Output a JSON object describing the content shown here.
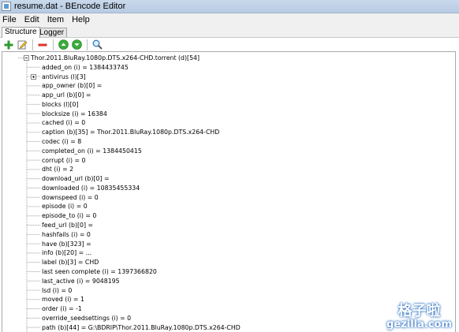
{
  "window": {
    "title": "resume.dat - BEncode Editor"
  },
  "menu": [
    "File",
    "Edit",
    "Item",
    "Help"
  ],
  "tabs": {
    "structure": "Structure",
    "logger": "Logger"
  },
  "toolbar": {
    "icons": [
      "add-icon",
      "edit-icon",
      "remove-icon",
      "move-up-icon",
      "move-down-icon",
      "search-icon"
    ]
  },
  "tree": {
    "root": "Thor.2011.BluRay.1080p.DTS.x264-CHD.torrent (d)[54]",
    "children": [
      {
        "text": "added_on (i) = 1384433745",
        "expandable": false
      },
      {
        "text": "antivirus (l)[3]",
        "expandable": true
      },
      {
        "text": "app_owner (b)[0] =",
        "expandable": false
      },
      {
        "text": "app_url (b)[0] =",
        "expandable": false
      },
      {
        "text": "blocks (l)[0]",
        "expandable": false
      },
      {
        "text": "blocksize (i) = 16384",
        "expandable": false
      },
      {
        "text": "cached (i) = 0",
        "expandable": false
      },
      {
        "text": "caption (b)[35] = Thor.2011.BluRay.1080p.DTS.x264-CHD",
        "expandable": false
      },
      {
        "text": "codec (i) = 8",
        "expandable": false
      },
      {
        "text": "completed_on (i) = 1384450415",
        "expandable": false
      },
      {
        "text": "corrupt (i) = 0",
        "expandable": false
      },
      {
        "text": "dht (i) = 2",
        "expandable": false
      },
      {
        "text": "download_url (b)[0] =",
        "expandable": false
      },
      {
        "text": "downloaded (i) = 10835455334",
        "expandable": false
      },
      {
        "text": "downspeed (i) = 0",
        "expandable": false
      },
      {
        "text": "episode (i) = 0",
        "expandable": false
      },
      {
        "text": "episode_to (i) = 0",
        "expandable": false
      },
      {
        "text": "feed_url (b)[0] =",
        "expandable": false
      },
      {
        "text": "hashfails (i) = 0",
        "expandable": false
      },
      {
        "text": "have (b)[323] =",
        "expandable": false
      },
      {
        "text": "info (b)[20] = ...",
        "expandable": false
      },
      {
        "text": "label (b)[3] = CHD",
        "expandable": false
      },
      {
        "text": "last seen complete (i) = 1397366820",
        "expandable": false
      },
      {
        "text": "last_active (i) = 9048195",
        "expandable": false
      },
      {
        "text": "lsd (i) = 0",
        "expandable": false
      },
      {
        "text": "moved (i) = 1",
        "expandable": false
      },
      {
        "text": "order (i) = -1",
        "expandable": false
      },
      {
        "text": "override_seedsettings (i) = 0",
        "expandable": false
      },
      {
        "text": "path (b)[44] = G:\\BDRIP\\Thor.2011.BluRay.1080p.DTS.x264-CHD",
        "expandable": false
      }
    ]
  },
  "watermark": {
    "cn": "格子啦",
    "en": "gezilla.com"
  }
}
